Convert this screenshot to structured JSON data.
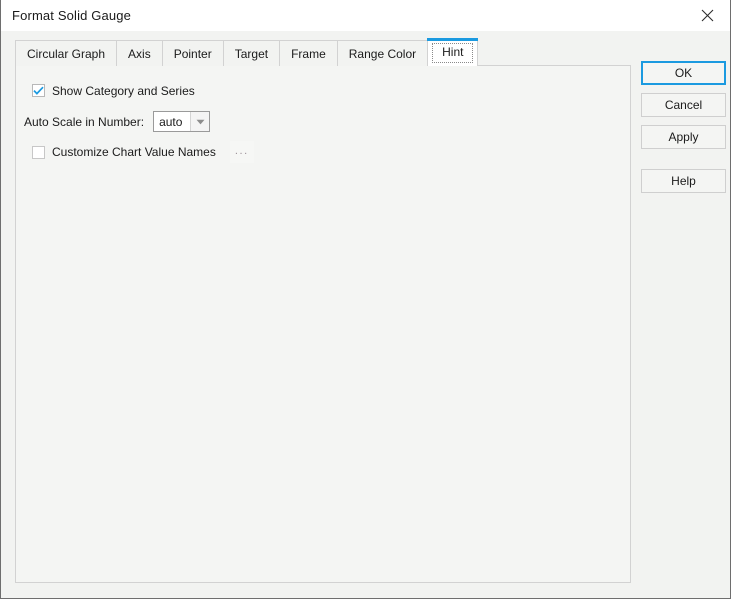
{
  "window": {
    "title": "Format Solid Gauge",
    "close_icon": "close-icon",
    "accent_color": "#1b9ae0",
    "background_color": "#f2f3f1",
    "panel_color": "#f4f5f3"
  },
  "tabs": {
    "items": [
      {
        "label": "Circular Graph",
        "active": false
      },
      {
        "label": "Axis",
        "active": false
      },
      {
        "label": "Pointer",
        "active": false
      },
      {
        "label": "Target",
        "active": false
      },
      {
        "label": "Frame",
        "active": false
      },
      {
        "label": "Range Color",
        "active": false
      },
      {
        "label": "Hint",
        "active": true
      }
    ]
  },
  "hint_panel": {
    "show_category_and_series": {
      "label": "Show Category and Series",
      "checked": true
    },
    "auto_scale_in_number": {
      "label": "Auto Scale in Number:",
      "value": "auto",
      "options": [
        "auto"
      ],
      "arrow_icon": "chevron-down-icon"
    },
    "customize_chart_value_names": {
      "label": "Customize Chart Value Names",
      "checked": false,
      "browse_button_label": "..."
    }
  },
  "actions": {
    "ok": "OK",
    "cancel": "Cancel",
    "apply": "Apply",
    "help": "Help"
  }
}
